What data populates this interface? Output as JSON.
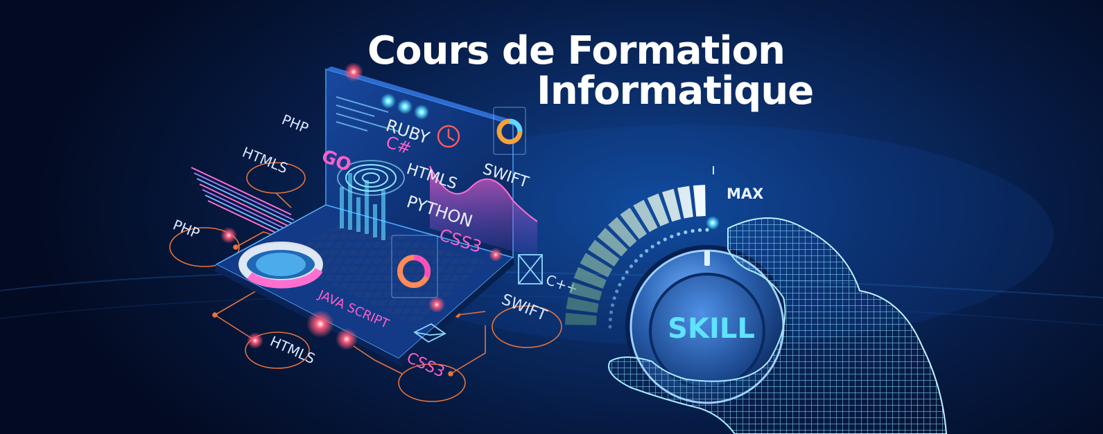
{
  "heading": {
    "line1": "Cours de Formation",
    "line2": "Informatique"
  },
  "knob": {
    "label": "SKILL",
    "max_label": "MAX",
    "level": 1.0
  },
  "labels": {
    "php_top": "PHP",
    "htmls_top": "HTMLS",
    "go": "GO",
    "ruby": "RUBY",
    "csharp": "C#",
    "htmls_screen": "HTMLS",
    "swift_top": "SWIFT",
    "python": "PYTHON",
    "css3_screen": "CSS3",
    "php_left": "PHP",
    "cpp": "C++",
    "java_script": "JAVA SCRIPT",
    "swift_bottom": "SWIFT",
    "htmls_bottom": "HTMLS",
    "css3_bottom": "CSS3"
  },
  "colors": {
    "accent_cyan": "#5fd8ff",
    "accent_pink": "#ff4fb8",
    "accent_orange": "#f0803c",
    "accent_red": "#ff5a6a",
    "knob_steel": "#2f6fb8"
  },
  "icons": [
    "laptop-icon",
    "hand-icon",
    "knob-icon",
    "envelope-icon",
    "clock-icon",
    "donut-chart-icon"
  ]
}
